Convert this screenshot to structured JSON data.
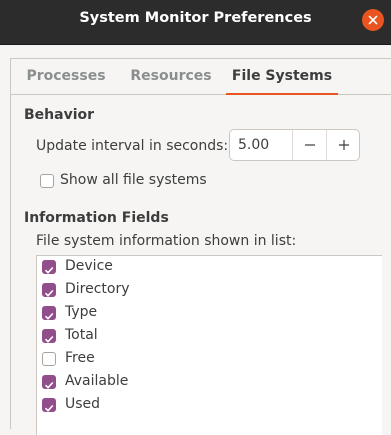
{
  "window": {
    "title": "System Monitor Preferences",
    "close_icon": "close-icon",
    "accent_color": "#e95420"
  },
  "tabs": [
    {
      "label": "Processes",
      "active": false
    },
    {
      "label": "Resources",
      "active": false
    },
    {
      "label": "File Systems",
      "active": true
    }
  ],
  "behavior": {
    "heading": "Behavior",
    "update_interval_label": "Update interval in seconds:",
    "update_interval_value": "5.00",
    "decrement_icon": "minus-icon",
    "increment_icon": "plus-icon",
    "show_all_label": "Show all file systems",
    "show_all_checked": false
  },
  "info_fields": {
    "heading": "Information Fields",
    "description": "File system information shown in list:",
    "checked_color": "#924d8b",
    "items": [
      {
        "label": "Device",
        "checked": true
      },
      {
        "label": "Directory",
        "checked": true
      },
      {
        "label": "Type",
        "checked": true
      },
      {
        "label": "Total",
        "checked": true
      },
      {
        "label": "Free",
        "checked": false
      },
      {
        "label": "Available",
        "checked": true
      },
      {
        "label": "Used",
        "checked": true
      }
    ]
  }
}
